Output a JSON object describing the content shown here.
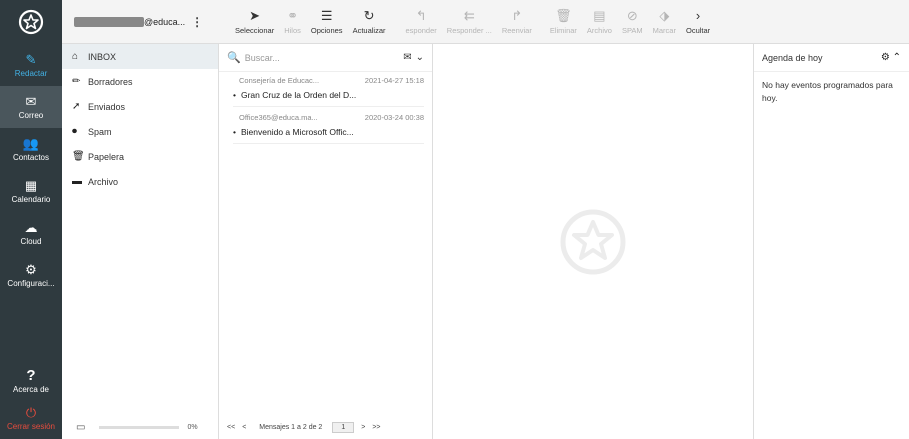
{
  "rail": {
    "items": [
      {
        "label": "Redactar",
        "icon": "compose-icon"
      },
      {
        "label": "Correo",
        "icon": "envelope-icon"
      },
      {
        "label": "Contactos",
        "icon": "contacts-icon"
      },
      {
        "label": "Calendario",
        "icon": "calendar-icon"
      },
      {
        "label": "Cloud",
        "icon": "cloud-icon"
      },
      {
        "label": "Configuraci...",
        "icon": "gear-icon"
      }
    ],
    "about": "Acerca de",
    "logout": "Cerrar sesión"
  },
  "account": {
    "domain": "@educa..."
  },
  "toolbar": {
    "select": "Seleccionar",
    "threads": "Hilos",
    "options": "Opciones",
    "refresh": "Actualizar",
    "reply": "esponder",
    "reply_all": "Responder ...",
    "forward": "Reenviar",
    "delete": "Eliminar",
    "archive": "Archivo",
    "spam": "SPAM",
    "mark": "Marcar",
    "hide": "Ocultar"
  },
  "folders": [
    {
      "label": "INBOX",
      "icon": "inbox-icon"
    },
    {
      "label": "Borradores",
      "icon": "pencil-icon"
    },
    {
      "label": "Enviados",
      "icon": "paper-plane-icon"
    },
    {
      "label": "Spam",
      "icon": "spam-icon"
    },
    {
      "label": "Papelera",
      "icon": "trash-icon"
    },
    {
      "label": "Archivo",
      "icon": "archive-icon"
    }
  ],
  "quota": {
    "percent": "0%",
    "fill": 0
  },
  "search": {
    "placeholder": "Buscar..."
  },
  "messages": [
    {
      "from": "Consejería de Educac...",
      "date": "2021-04-27 15:18",
      "subject": "Gran Cruz de la Orden del D..."
    },
    {
      "from": "Office365@educa.ma...",
      "date": "2020-03-24 00:38",
      "subject": "Bienvenido a Microsoft Offic..."
    }
  ],
  "pager": {
    "first": "<<",
    "prev": "<",
    "summary": "Mensajes 1 a 2 de 2",
    "page": "1",
    "next": ">",
    "last": ">>"
  },
  "agenda": {
    "title": "Agenda de hoy",
    "empty": "No hay eventos programados para hoy."
  },
  "colors": {
    "rail": "#2f3a3f",
    "accent": "#42b0e3",
    "logout": "#e84c3d"
  }
}
